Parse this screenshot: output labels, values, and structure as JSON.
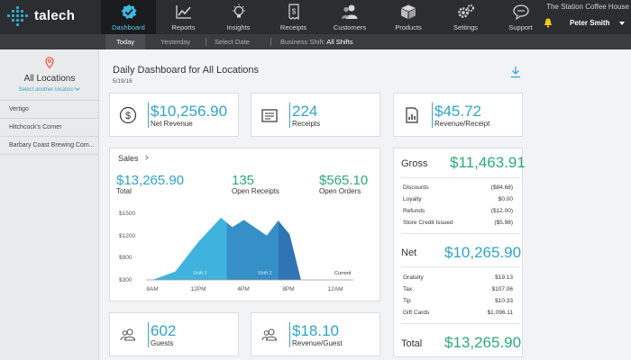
{
  "app": {
    "brand": "talech",
    "store_name": "The Station Coffee House",
    "user_name": "Peter Smith",
    "accent": "#2fa4c9",
    "green": "#2baa7a"
  },
  "nav": [
    {
      "label": "Dashboard",
      "icon": "dashboard-check-icon",
      "active": true
    },
    {
      "label": "Reports",
      "icon": "line-chart-icon"
    },
    {
      "label": "Insights",
      "icon": "lightbulb-icon"
    },
    {
      "label": "Receipts",
      "icon": "receipt-dollar-icon"
    },
    {
      "label": "Customers",
      "icon": "customers-icon"
    },
    {
      "label": "Products",
      "icon": "box-icon"
    },
    {
      "label": "Settings",
      "icon": "gears-icon"
    },
    {
      "label": "Support",
      "icon": "chat-bubble-icon"
    }
  ],
  "subnav": {
    "today": "Today",
    "yesterday": "Yesterday",
    "select_date": "Select Date",
    "shift_label": "Business Shift:",
    "shift_value": "All Shifts"
  },
  "sidebar": {
    "title": "All Locations",
    "select_link": "Select another location",
    "locations": [
      "Vertigo",
      "Hitchcock's Corner",
      "Barbary Coast Brewing Com..."
    ]
  },
  "main": {
    "title_prefix": "Daily Dashboard",
    "title_suffix": "for All Locations",
    "date": "5/19/16"
  },
  "kpis": {
    "net_revenue": {
      "value": "$10,256.90",
      "label": "Net Revenue",
      "icon": "dollar-circle-icon"
    },
    "receipts": {
      "value": "224",
      "label": "Receipts",
      "icon": "register-icon"
    },
    "revenue_receipt": {
      "value": "$45.72",
      "label": "Revenue/Receipt",
      "icon": "receipt-chart-icon"
    },
    "guests": {
      "value": "602",
      "label": "Guests",
      "icon": "guests-icon"
    },
    "revenue_guest": {
      "value": "$18.10",
      "label": "Revenue/Guest",
      "icon": "guests-icon"
    }
  },
  "sales": {
    "title": "Sales",
    "total": {
      "value": "$13,265.90",
      "label": "Total"
    },
    "open_receipts": {
      "value": "135",
      "label": "Open Receipts"
    },
    "open_orders": {
      "value": "$565.10",
      "label": "Open Orders"
    }
  },
  "chart_data": {
    "type": "area",
    "x_ticks": [
      "8AM",
      "12PM",
      "4PM",
      "8PM",
      "12AM"
    ],
    "y_ticks": [
      "$1500",
      "$1200",
      "$900",
      "$300"
    ],
    "annotations": [
      "Shift 1",
      "Shift 2",
      "Current"
    ],
    "x": [
      "8AM",
      "10AM",
      "12PM",
      "2PM",
      "3PM",
      "4PM",
      "6PM",
      "7PM",
      "8PM",
      "9PM"
    ],
    "values": [
      300,
      450,
      980,
      1420,
      1250,
      1380,
      1100,
      1370,
      1120,
      300
    ],
    "series_colors": [
      "#3fb3dd",
      "#3590c7",
      "#2f74b3"
    ],
    "color": "#3fb3dd"
  },
  "summary": {
    "gross": {
      "label": "Gross",
      "value": "$11,463.91"
    },
    "gross_rows": [
      {
        "label": "Discounts",
        "value": "($84.68)"
      },
      {
        "label": "Loyalty",
        "value": "$0.00"
      },
      {
        "label": "Refunds",
        "value": "($12.00)"
      },
      {
        "label": "Store Credit Issued",
        "value": "($5.98)"
      }
    ],
    "net": {
      "label": "Net",
      "value": "$10,265.90"
    },
    "net_rows": [
      {
        "label": "Gratuity",
        "value": "$19.13"
      },
      {
        "label": "Tax",
        "value": "$107.06"
      },
      {
        "label": "Tip",
        "value": "$10.33"
      },
      {
        "label": "Gift Cards",
        "value": "$1,096.11"
      }
    ],
    "total": {
      "label": "Total",
      "value": "$13,265.90"
    }
  }
}
